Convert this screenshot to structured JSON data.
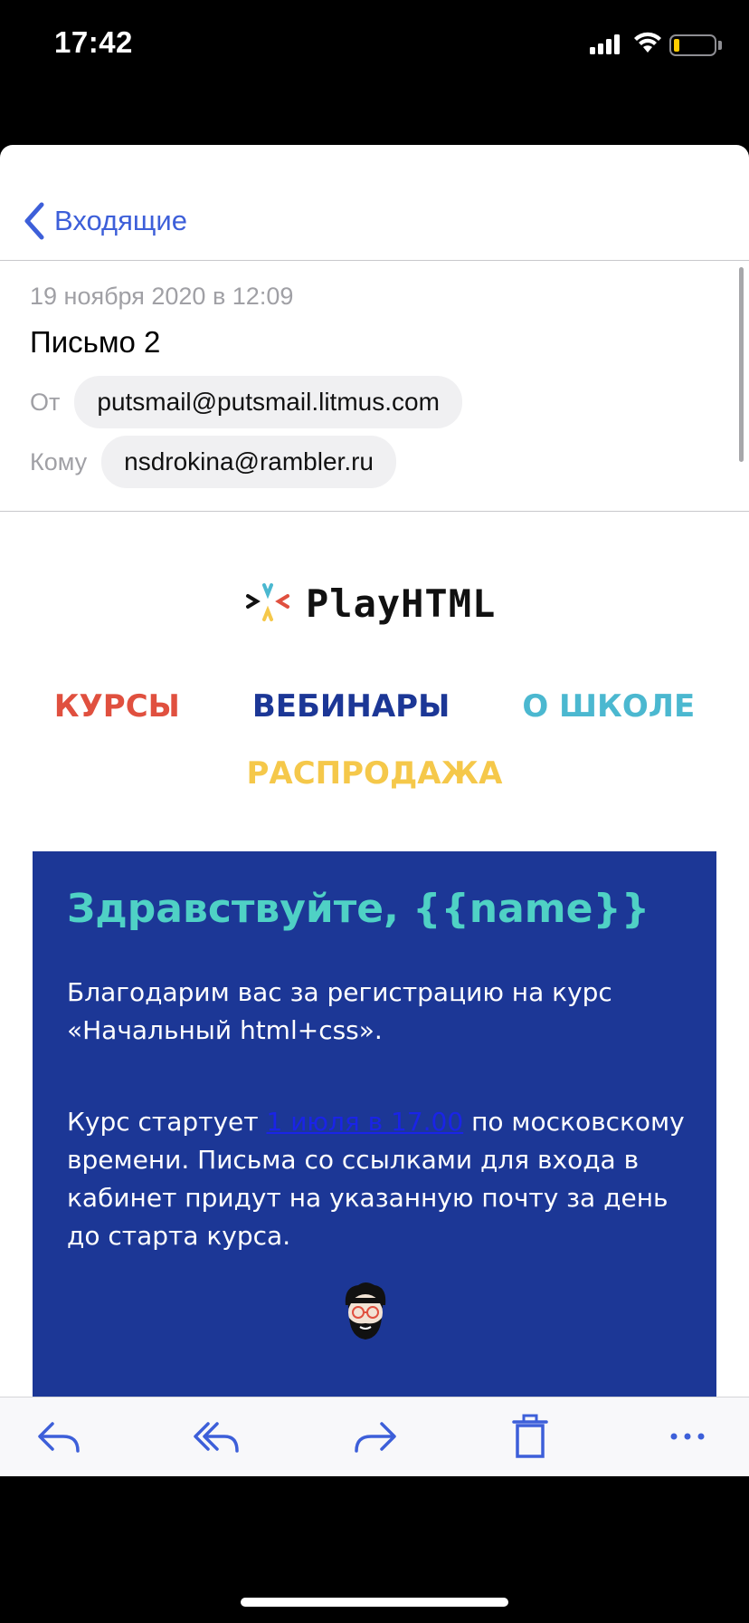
{
  "status_bar": {
    "time": "17:42"
  },
  "nav": {
    "back_label": "Входящие"
  },
  "mail": {
    "date": "19 ноября 2020 в 12:09",
    "subject": "Письмо 2",
    "from_label": "От",
    "from_address": "putsmail@putsmail.litmus.com",
    "to_label": "Кому",
    "to_address": "nsdrokina@rambler.ru"
  },
  "email_body": {
    "logo_text": "PlayHTML",
    "menu": [
      {
        "label": "КУРСЫ",
        "color": "#e0503f"
      },
      {
        "label": "ВЕБИНАРЫ",
        "color": "#1c3796"
      },
      {
        "label": "О ШКОЛЕ",
        "color": "#4bb8d0"
      },
      {
        "label": "РАСПРОДАЖА",
        "color": "#f5c84a"
      }
    ],
    "greeting": "Здравствуйте, {{name}}",
    "paragraph1": "Благодарим вас за регистрацию на курс «Начальный html+css».",
    "paragraph2_before": "Курс стартует ",
    "paragraph2_link": "1 июля в 17.00",
    "paragraph2_after": " по московскому времени. Письма со ссылками для входа в кабинет придут на указанную почту за день до старта курса.",
    "card_color": "#1c3796",
    "greeting_color": "#4fd1c5"
  },
  "toolbar": {
    "icons": [
      "reply-icon",
      "reply-all-icon",
      "forward-icon",
      "trash-icon",
      "more-icon"
    ]
  },
  "colors": {
    "accent": "#3d5fd9"
  }
}
